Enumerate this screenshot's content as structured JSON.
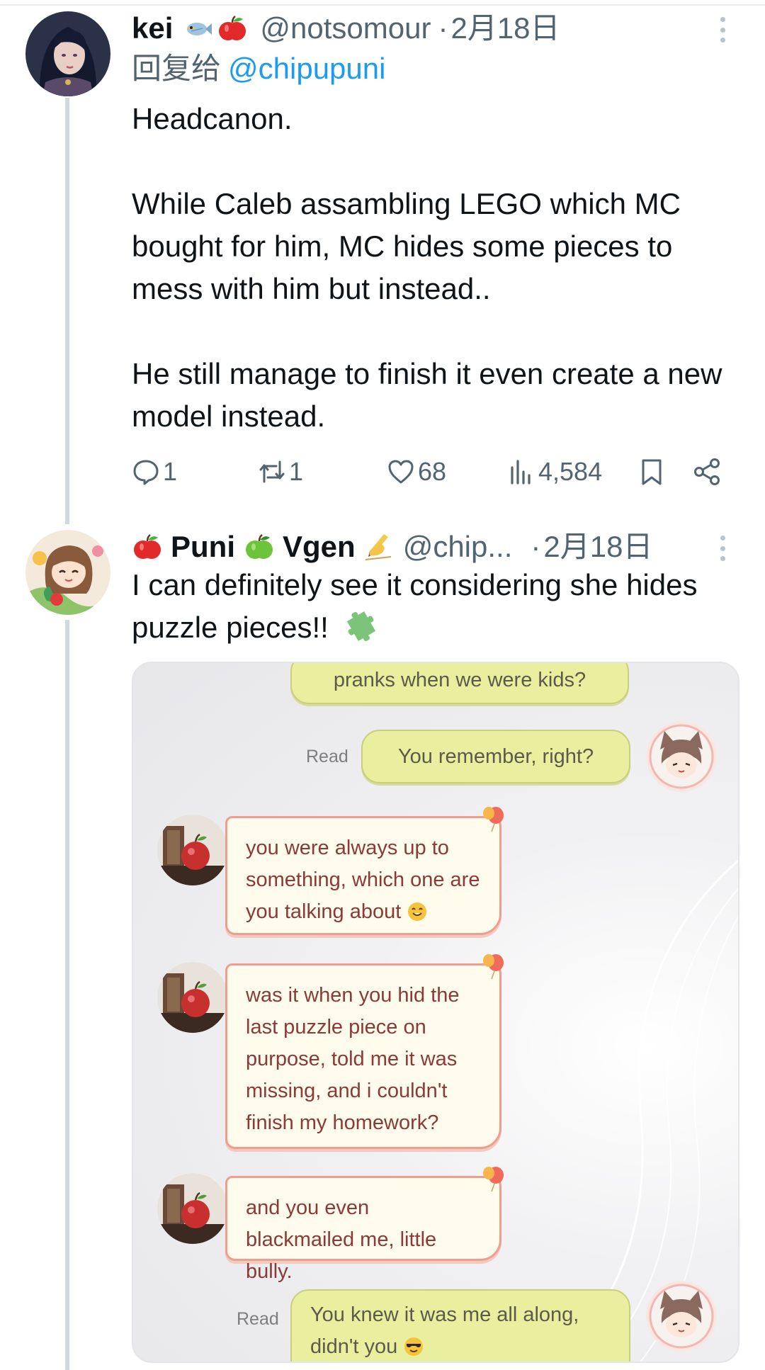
{
  "tweets": [
    {
      "author": "kei",
      "handle": "@notsomour",
      "separator": "·",
      "date": "2月18日",
      "reply_label": "回复给",
      "reply_mention": "@chipupuni",
      "body": [
        "Headcanon.",
        "While Caleb assambling LEGO which MC bought for him, MC hides some pieces to mess with him but instead..",
        "He still manage to finish it even create a new model instead."
      ],
      "name_emojis": [
        "fish-emoji",
        "apple-emoji"
      ],
      "stats": {
        "replies": "1",
        "reposts": "1",
        "likes": "68",
        "views": "4,584"
      }
    },
    {
      "author_part1": "Puni",
      "author_part2": "Vgen",
      "name_emojis": [
        "red-apple-emoji",
        "green-apple-emoji",
        "writing-hand-emoji"
      ],
      "handle": "@chip...",
      "separator": "·",
      "date": "2月18日",
      "body": "I can definitely see it considering she hides puzzle pieces!!",
      "body_emoji": "puzzle-emoji"
    }
  ],
  "chat": {
    "messages": [
      {
        "side": "me",
        "text": "pranks when we were kids?"
      },
      {
        "side": "me",
        "read": "Read",
        "text": "You remember, right?"
      },
      {
        "side": "them",
        "text": "you were always up to something, which one are you talking about"
      },
      {
        "side": "them",
        "text": "was it when you hid the last puzzle piece on purpose, told me it was missing, and i couldn't finish my homework?"
      },
      {
        "side": "them",
        "text": "and you even blackmailed me, little bully."
      },
      {
        "side": "me",
        "read": "Read",
        "text": "You knew it was me all along, didn't you"
      }
    ]
  },
  "colors": {
    "text": "#0f1419",
    "secondary": "#536471",
    "link": "#1d9bf0",
    "thread_line": "#cfd9de",
    "green_bubble": "#e9ef9f",
    "cream_bubble": "#fffbed",
    "cream_border": "#ee9e8d"
  }
}
